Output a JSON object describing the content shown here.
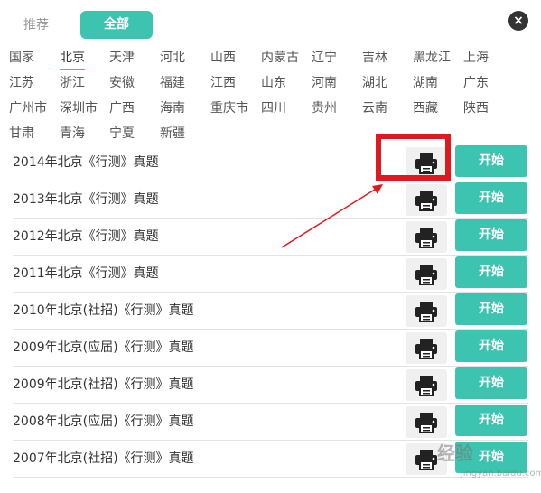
{
  "tabs": {
    "recommend": "推荐",
    "all": "全部"
  },
  "close_label": "×",
  "regions": [
    [
      "国家",
      "北京",
      "天津",
      "河北",
      "山西",
      "内蒙古",
      "辽宁",
      "吉林",
      "黑龙江",
      "上海"
    ],
    [
      "江苏",
      "浙江",
      "安徽",
      "福建",
      "江西",
      "山东",
      "河南",
      "湖北",
      "湖南",
      "广东"
    ],
    [
      "广州市",
      "深圳市",
      "广西",
      "海南",
      "重庆市",
      "四川",
      "贵州",
      "云南",
      "西藏",
      "陕西"
    ],
    [
      "甘肃",
      "青海",
      "宁夏",
      "新疆"
    ]
  ],
  "active_region": "北京",
  "exams": [
    {
      "title": "2014年北京《行测》真题",
      "start": "开始"
    },
    {
      "title": "2013年北京《行测》真题",
      "start": "开始"
    },
    {
      "title": "2012年北京《行测》真题",
      "start": "开始"
    },
    {
      "title": "2011年北京《行测》真题",
      "start": "开始"
    },
    {
      "title": "2010年北京(社招)《行测》真题",
      "start": "开始"
    },
    {
      "title": "2009年北京(应届)《行测》真题",
      "start": "开始"
    },
    {
      "title": "2009年北京(社招)《行测》真题",
      "start": "开始"
    },
    {
      "title": "2008年北京(应届)《行测》真题",
      "start": "开始"
    },
    {
      "title": "2007年北京(社招)《行测》真题",
      "start": "开始"
    }
  ],
  "watermark": {
    "text": "经验",
    "sub": "jingyan.baidu.com"
  },
  "colors": {
    "accent": "#3dc4b1",
    "highlight": "#e0191e"
  },
  "icons": {
    "print": "printer-icon",
    "close": "close-icon"
  }
}
